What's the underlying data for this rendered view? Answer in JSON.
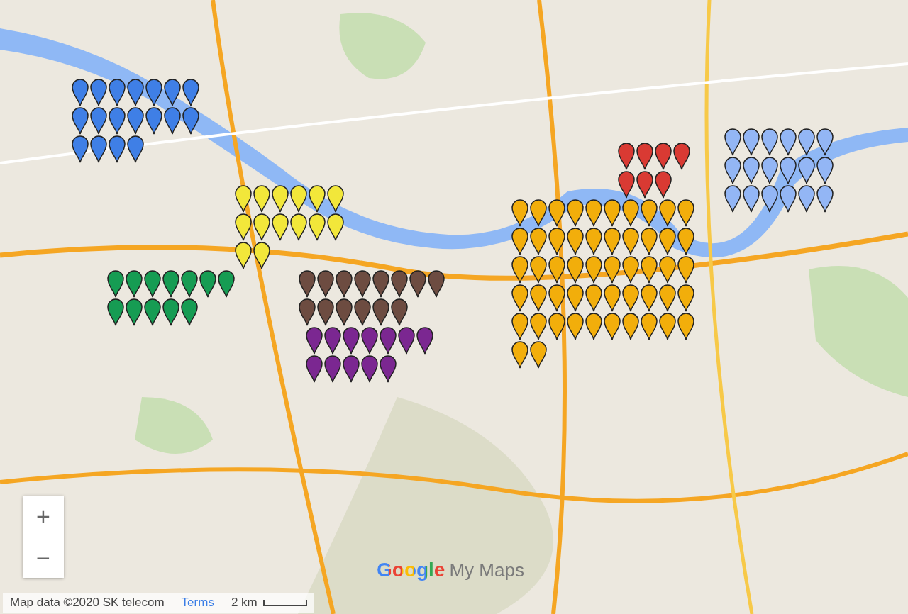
{
  "marker_groups": [
    {
      "color": "#3f7fe6"
    },
    {
      "color": "#f2e73a"
    },
    {
      "color": "#169c53"
    },
    {
      "color": "#6d4c41"
    },
    {
      "color": "#7b2791"
    },
    {
      "color": "#f2ae0b"
    },
    {
      "color": "#d93a33"
    },
    {
      "color": "#93b6f5"
    }
  ],
  "zoom_controls": [
    {
      "label": "+"
    },
    {
      "label": "−"
    }
  ],
  "logo": {
    "brand": "Google",
    "product": "My Maps"
  },
  "footer": {
    "attribution": "Map data ©2020 SK telecom",
    "terms": "Terms",
    "scale": "2 km"
  }
}
